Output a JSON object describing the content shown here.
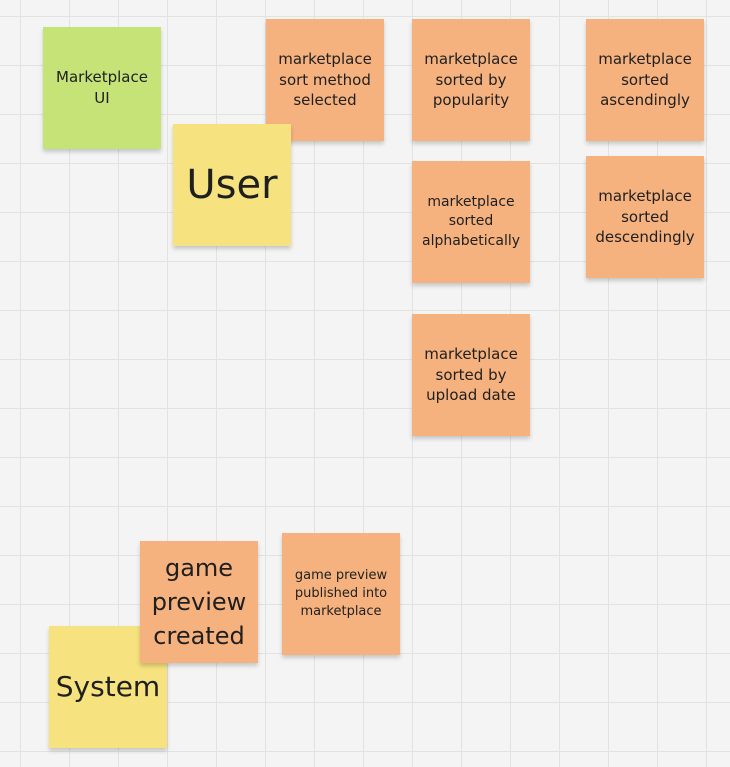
{
  "stickies": {
    "marketplace_ui": "Marketplace UI",
    "user": "User",
    "sort_method_selected": "marketplace sort method selected",
    "sorted_by_popularity": "marketplace sorted by popularity",
    "sorted_ascendingly": "marketplace sorted ascendingly",
    "sorted_alphabetically": "marketplace sorted alphabetically",
    "sorted_descendingly": "marketplace sorted descendingly",
    "sorted_by_upload_date": "marketplace sorted by upload date",
    "game_preview_created": "game preview created",
    "game_preview_published": "game preview published into marketplace",
    "system": "System"
  },
  "colors": {
    "event": "#f5b27e",
    "ui": "#c6e377",
    "actor": "#f6e27e"
  }
}
